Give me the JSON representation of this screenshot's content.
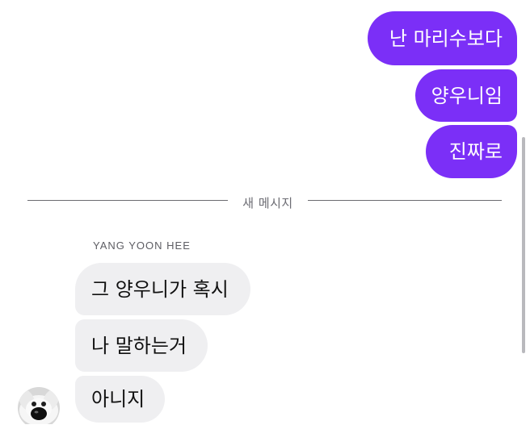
{
  "divider": {
    "label": "새 메시지"
  },
  "outgoing_messages": [
    {
      "text": "난 마리수보다"
    },
    {
      "text": "양우니임"
    },
    {
      "text": "진짜로"
    }
  ],
  "incoming": {
    "sender_name": "YANG YOON HEE",
    "avatar_icon": "dog-avatar",
    "messages": [
      {
        "text": "그 양우니가 혹시"
      },
      {
        "text": "나 말하는거"
      },
      {
        "text": "아니지"
      }
    ]
  },
  "colors": {
    "outgoing_bubble": "#7b2ff7",
    "incoming_bubble": "#efeff1",
    "divider_line": "#6b6b70"
  }
}
